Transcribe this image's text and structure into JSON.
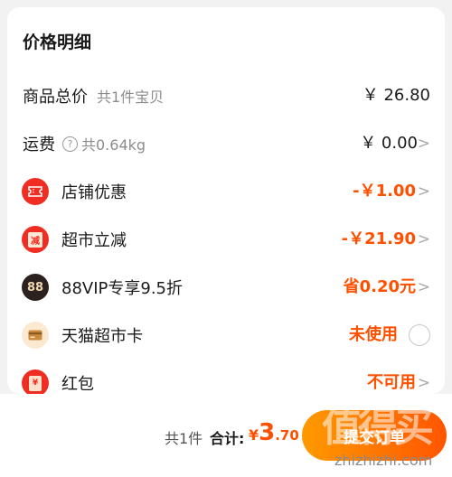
{
  "card": {
    "title": "价格明细"
  },
  "rows": {
    "goods": {
      "label": "商品总价",
      "sub": "共1件宝贝",
      "value": "￥ 26.80"
    },
    "shipping": {
      "label": "运费",
      "help": "?",
      "sub": "共0.64kg",
      "value": "￥ 0.00",
      "chevron": ">"
    },
    "shop": {
      "label": "店铺优惠",
      "value": "-￥1.00",
      "chevron": ">"
    },
    "market": {
      "label": "超市立减",
      "icon_text": "减",
      "value": "-￥21.90",
      "chevron": ">"
    },
    "vip": {
      "label": "88VIP专享9.5折",
      "icon_text": "88",
      "value": "省0.20元",
      "chevron": ">"
    },
    "card": {
      "label": "天猫超市卡",
      "value": "未使用"
    },
    "redpack": {
      "label": "红包",
      "icon_text": "¥",
      "value": "不可用",
      "chevron": ">"
    }
  },
  "footer": {
    "count": "共1件",
    "total_label": "合计:",
    "currency": "¥",
    "amount_int": "3",
    "amount_dec": ".70",
    "submit": "提交订单"
  },
  "watermark": {
    "logo": "值得买",
    "url": "zhizhizhi.com"
  },
  "colors": {
    "accent": "#ff5000",
    "button_start": "#ff9a00",
    "button_end": "#ff5500",
    "icon_red": "#f02d22",
    "vip_dark": "#2b2220"
  }
}
